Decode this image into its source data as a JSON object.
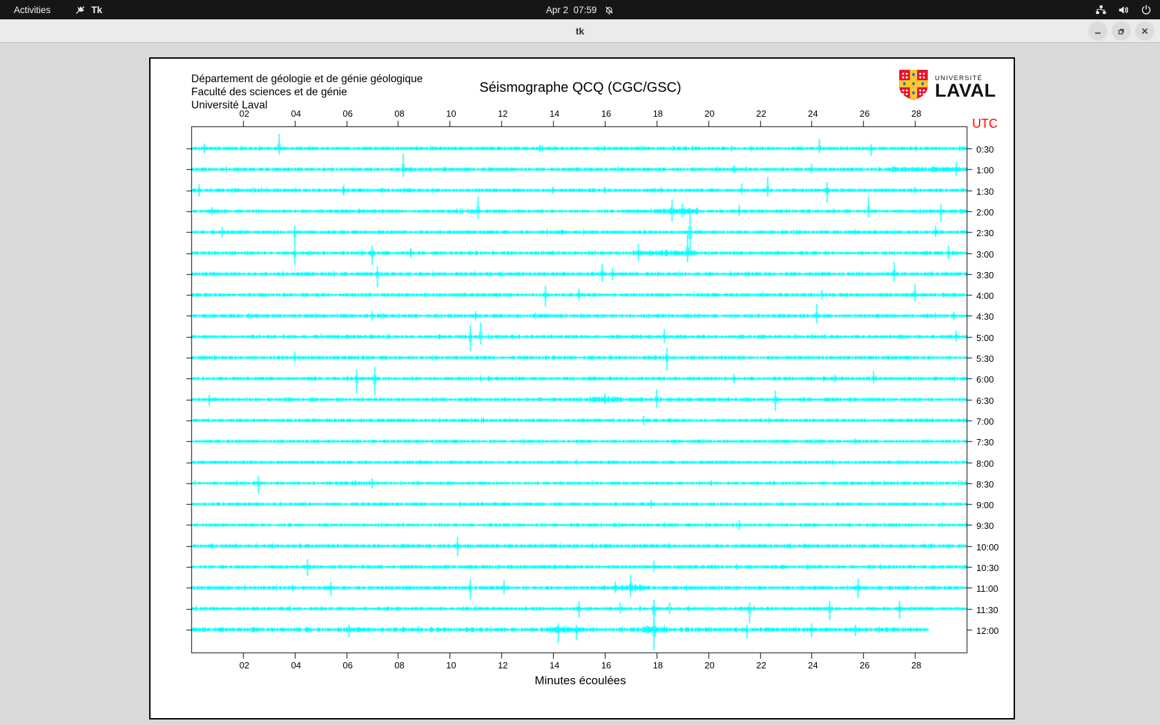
{
  "topbar": {
    "activities": "Activities",
    "app_name": "Tk",
    "clock": "Apr 2  07:59",
    "icons": [
      "tk-app-icon",
      "notifications-muted-icon",
      "network-wired-icon",
      "volume-icon",
      "power-icon"
    ]
  },
  "window": {
    "title": "tk",
    "controls": [
      "minimize",
      "maximize",
      "close"
    ]
  },
  "header": {
    "line1": "Département de géologie et de génie géologique",
    "line2": "Faculté des sciences et de génie",
    "line3": "Université Laval"
  },
  "logo": {
    "small": "UNIVERSITÉ",
    "large": "LAVAL"
  },
  "plot": {
    "title": "Séismographe QCQ (CGC/GSC)",
    "utc_label": "UTC",
    "xlabel": "Minutes écoulées"
  },
  "colors": {
    "trace": "#00ffff",
    "axis": "#000000",
    "utc_label": "#ff0000",
    "logo_red": "#e8112d",
    "logo_gold": "#ffc72c",
    "logo_blue": "#0072ce"
  },
  "chart_data": {
    "type": "seismogram",
    "title": "Séismographe QCQ (CGC/GSC)",
    "xlabel": "Minutes écoulées",
    "x_range_minutes": [
      0,
      30
    ],
    "x_ticks": [
      "02",
      "04",
      "06",
      "08",
      "10",
      "12",
      "14",
      "16",
      "18",
      "20",
      "22",
      "24",
      "26",
      "28"
    ],
    "trace_color": "#00ffff",
    "utc_axis_label": "UTC",
    "last_row_end_minute": 28.5,
    "rows": [
      {
        "label": "0:30",
        "spikes": [
          [
            0.5,
            7,
            7
          ],
          [
            3.4,
            21,
            9
          ],
          [
            13.5,
            5,
            5
          ],
          [
            24.3,
            14,
            7
          ],
          [
            26.3,
            6,
            11
          ]
        ]
      },
      {
        "label": "1:00",
        "spikes": [
          [
            8.2,
            23,
            11
          ],
          [
            21.0,
            6,
            6
          ],
          [
            24.0,
            8,
            6
          ],
          [
            29.6,
            11,
            9
          ]
        ],
        "bursts": [
          [
            27,
            30,
            1.5
          ]
        ]
      },
      {
        "label": "1:30",
        "spikes": [
          [
            0.3,
            9,
            9
          ],
          [
            5.9,
            8,
            8
          ],
          [
            14.0,
            5,
            5
          ],
          [
            21.3,
            10,
            6
          ],
          [
            22.3,
            19,
            9
          ],
          [
            24.6,
            12,
            18
          ],
          [
            28.0,
            5,
            5
          ]
        ]
      },
      {
        "label": "2:00",
        "spikes": [
          [
            0.8,
            6,
            6
          ],
          [
            11.1,
            21,
            11
          ],
          [
            18.6,
            17,
            15
          ],
          [
            19.0,
            11,
            9
          ],
          [
            21.2,
            9,
            7
          ],
          [
            26.2,
            21,
            9
          ],
          [
            29.0,
            10,
            15
          ]
        ],
        "bursts": [
          [
            18,
            19.6,
            2.5
          ]
        ]
      },
      {
        "label": "2:30",
        "spikes": [
          [
            1.2,
            7,
            7
          ],
          [
            4.0,
            9,
            21
          ],
          [
            19.3,
            25,
            32
          ],
          [
            28.8,
            9,
            7
          ]
        ]
      },
      {
        "label": "3:00",
        "spikes": [
          [
            4.0,
            9,
            17
          ],
          [
            7.0,
            11,
            17
          ],
          [
            8.5,
            7,
            7
          ],
          [
            17.3,
            13,
            11
          ],
          [
            19.2,
            28,
            13
          ],
          [
            29.3,
            11,
            9
          ]
        ],
        "bursts": [
          [
            17,
            19.5,
            2
          ]
        ]
      },
      {
        "label": "3:30",
        "spikes": [
          [
            7.2,
            11,
            19
          ],
          [
            15.9,
            15,
            11
          ],
          [
            16.3,
            9,
            9
          ],
          [
            27.2,
            17,
            11
          ]
        ]
      },
      {
        "label": "4:00",
        "spikes": [
          [
            13.7,
            13,
            17
          ],
          [
            15.0,
            9,
            7
          ],
          [
            24.4,
            7,
            7
          ],
          [
            28.0,
            15,
            9
          ]
        ]
      },
      {
        "label": "4:30",
        "spikes": [
          [
            7.0,
            7,
            7
          ],
          [
            11.0,
            7,
            7
          ],
          [
            24.2,
            17,
            11
          ],
          [
            29.5,
            6,
            6
          ]
        ]
      },
      {
        "label": "5:00",
        "spikes": [
          [
            10.8,
            17,
            21
          ],
          [
            11.2,
            21,
            11
          ],
          [
            18.3,
            11,
            9
          ],
          [
            29.6,
            9,
            7
          ]
        ]
      },
      {
        "label": "5:30",
        "spikes": [
          [
            4.0,
            9,
            7
          ],
          [
            18.4,
            15,
            19
          ]
        ]
      },
      {
        "label": "6:00",
        "spikes": [
          [
            6.4,
            13,
            21
          ],
          [
            7.1,
            17,
            25
          ],
          [
            21.0,
            7,
            7
          ],
          [
            24.9,
            6,
            6
          ],
          [
            26.4,
            11,
            7
          ]
        ]
      },
      {
        "label": "6:30",
        "spikes": [
          [
            0.7,
            7,
            9
          ],
          [
            16.0,
            9,
            7
          ],
          [
            18.0,
            15,
            11
          ],
          [
            22.6,
            13,
            17
          ]
        ],
        "bursts": [
          [
            15.4,
            16.6,
            3
          ]
        ]
      },
      {
        "label": "7:00",
        "spikes": [
          [
            17.5,
            7,
            7
          ]
        ]
      },
      {
        "label": "7:30",
        "spikes": [],
        "noise": 1.8
      },
      {
        "label": "8:00",
        "spikes": [],
        "noise": 1.8
      },
      {
        "label": "8:30",
        "spikes": [
          [
            2.6,
            11,
            15
          ],
          [
            7.0,
            7,
            7
          ]
        ],
        "noise": 1.8
      },
      {
        "label": "9:00",
        "spikes": [
          [
            17.8,
            6,
            6
          ]
        ],
        "noise": 1.8
      },
      {
        "label": "9:30",
        "spikes": [
          [
            21.2,
            7,
            7
          ]
        ],
        "noise": 1.8
      },
      {
        "label": "10:00",
        "spikes": [
          [
            10.3,
            13,
            15
          ]
        ]
      },
      {
        "label": "10:30",
        "spikes": [
          [
            4.5,
            11,
            13
          ],
          [
            17.9,
            9,
            7
          ]
        ]
      },
      {
        "label": "11:00",
        "spikes": [
          [
            5.4,
            9,
            11
          ],
          [
            10.8,
            13,
            17
          ],
          [
            12.1,
            11,
            9
          ],
          [
            16.4,
            9,
            7
          ],
          [
            17.0,
            19,
            13
          ],
          [
            25.8,
            13,
            15
          ]
        ],
        "bursts": [
          [
            16.3,
            17.5,
            2.5
          ]
        ]
      },
      {
        "label": "11:30",
        "spikes": [
          [
            15.0,
            11,
            13
          ],
          [
            16.6,
            9,
            7
          ],
          [
            17.9,
            13,
            27
          ],
          [
            18.5,
            9,
            7
          ],
          [
            21.6,
            9,
            21
          ],
          [
            24.7,
            11,
            17
          ],
          [
            27.4,
            11,
            15
          ]
        ]
      },
      {
        "label": "12:00",
        "spikes": [
          [
            6.1,
            7,
            11
          ],
          [
            14.2,
            9,
            19
          ],
          [
            14.9,
            7,
            15
          ],
          [
            17.9,
            15,
            30
          ],
          [
            21.5,
            7,
            13
          ],
          [
            24.0,
            9,
            11
          ],
          [
            25.7,
            7,
            9
          ]
        ],
        "bursts": [
          [
            17.4,
            18.4,
            3
          ],
          [
            13.8,
            15.2,
            2
          ]
        ],
        "noise": 2.8,
        "end_minute": 28.5
      }
    ]
  }
}
